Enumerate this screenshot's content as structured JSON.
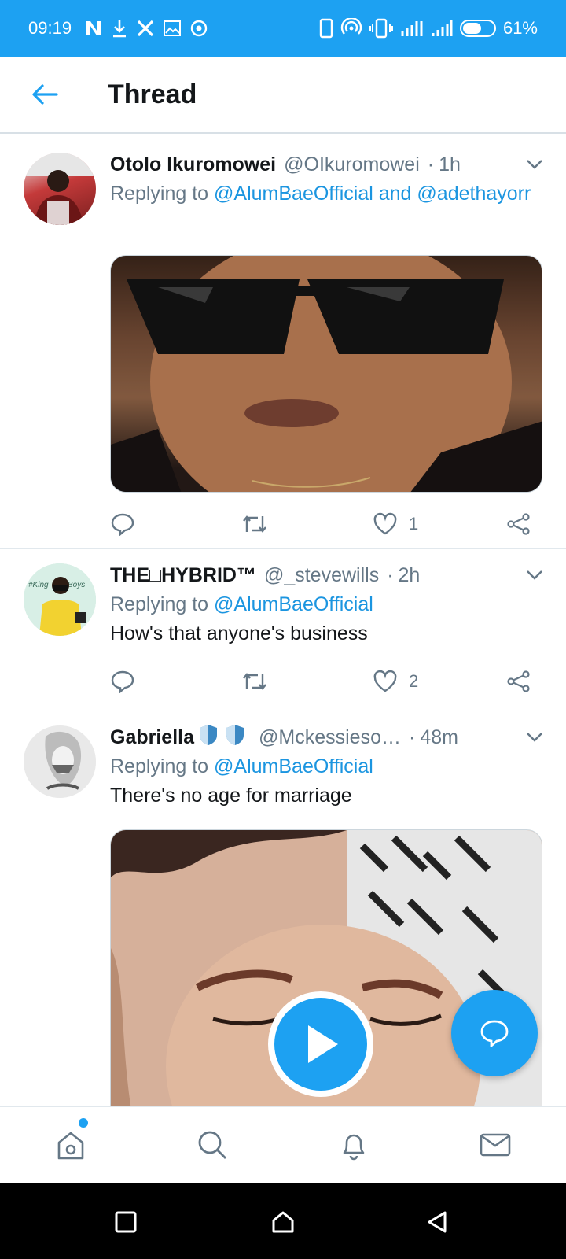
{
  "status_bar": {
    "time": "09:19",
    "battery": "61%",
    "battery_level": 0.61,
    "left_icons": [
      "netflix-icon",
      "download-icon",
      "x-icon",
      "image-icon",
      "circle-icon"
    ],
    "right_icons": [
      "phone-icon",
      "hotspot-icon",
      "vibrate-icon",
      "signal-icon",
      "signal-icon"
    ]
  },
  "header": {
    "title": "Thread",
    "back_icon": "arrow-left-icon"
  },
  "tweets": [
    {
      "name": "Otolo Ikuromowei",
      "handle": "@OIkuromowei",
      "time": "1h",
      "replying_prefix": "Replying to",
      "mentions": "@AlumBaeOfficial and @adethayorr",
      "text": "",
      "likes": "1",
      "has_media": true
    },
    {
      "name": "THE□HYBRID™",
      "handle": "@_stevewills",
      "time": "2h",
      "replying_prefix": "Replying to",
      "mentions": "@AlumBaeOfficial",
      "text": "How's that anyone's business",
      "likes": "2",
      "has_media": false
    },
    {
      "name": "Gabriella",
      "handle": "@Mckessieso…",
      "time": "48m",
      "replying_prefix": "Replying to",
      "mentions": "@AlumBaeOfficial",
      "text": "There's no age for marriage",
      "likes": "",
      "has_media": true,
      "media_type": "video"
    }
  ],
  "tabs": [
    "home-icon",
    "search-icon",
    "notifications-icon",
    "messages-icon"
  ],
  "system_nav": [
    "recents-icon",
    "home-button-icon",
    "back-triangle-icon"
  ],
  "colors": {
    "accent": "#1da1f2",
    "mention": "#1b95e0",
    "muted": "#657786",
    "text": "#14171a"
  }
}
